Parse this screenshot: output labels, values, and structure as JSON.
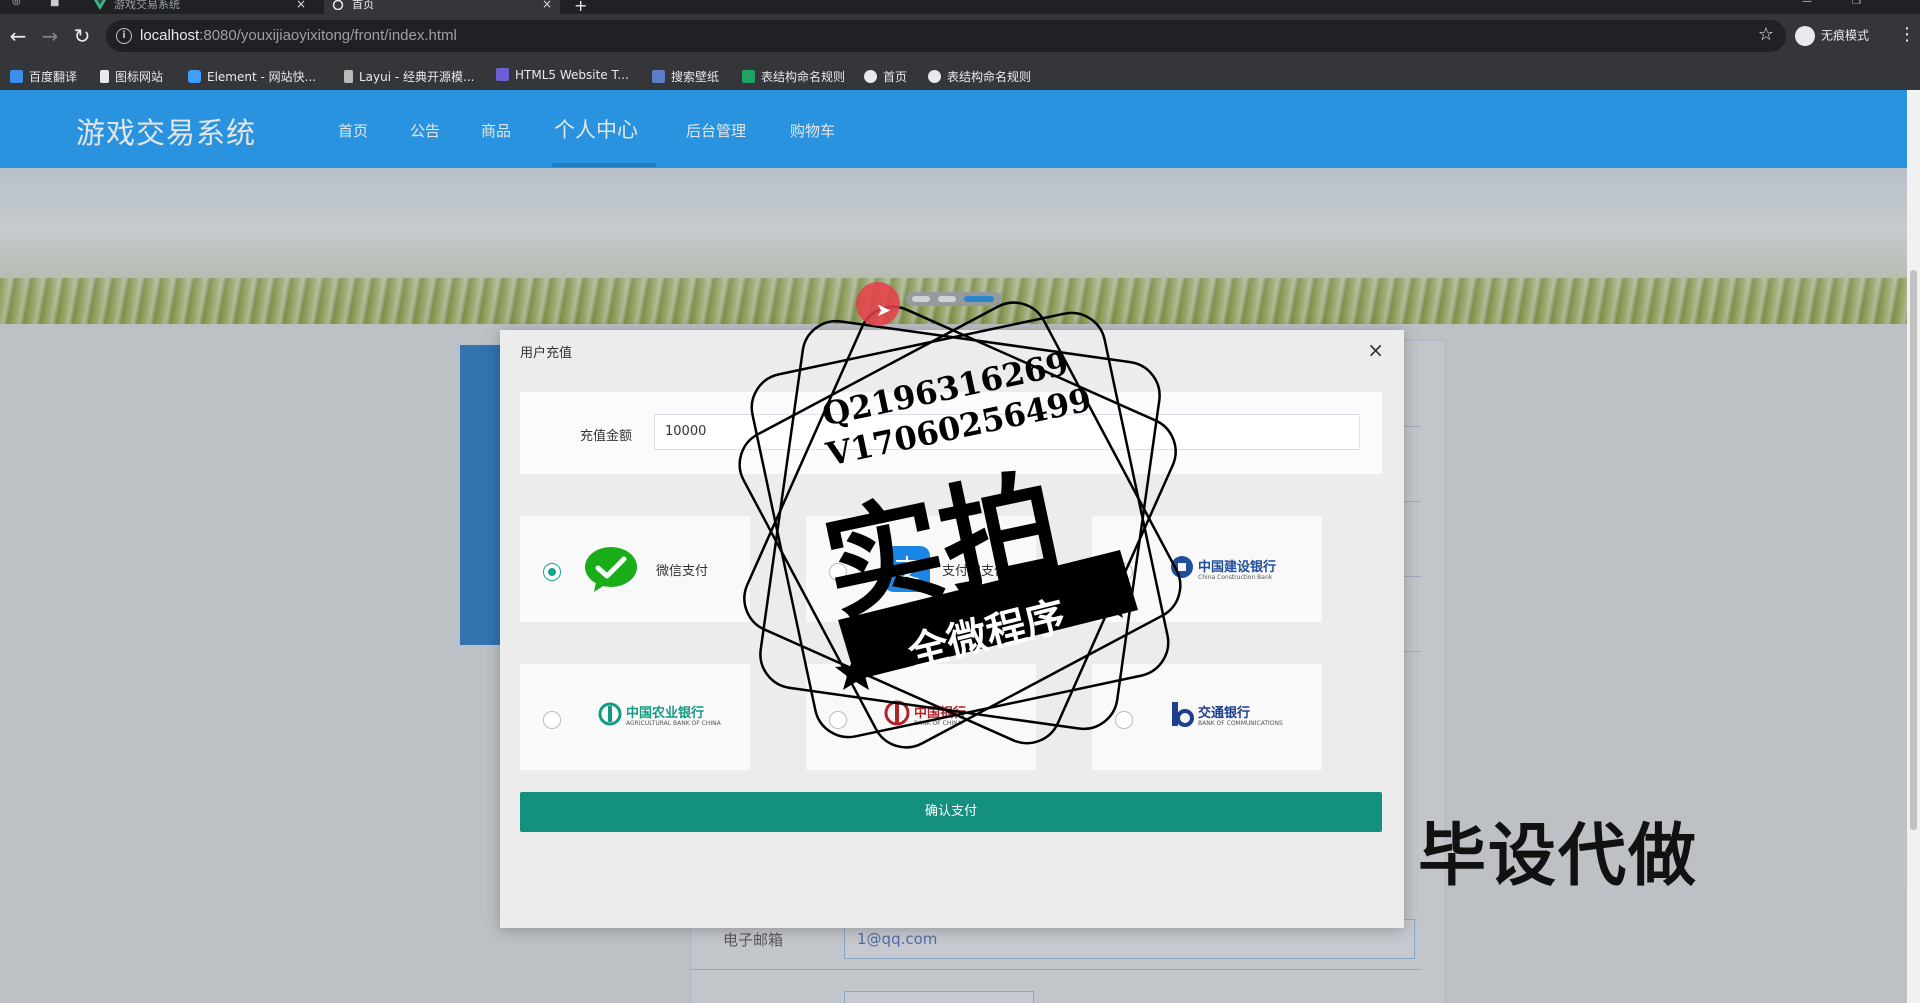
{
  "browser": {
    "tabs": [
      {
        "label": "游戏交易系统",
        "active": false
      },
      {
        "label": "首页",
        "active": true
      }
    ],
    "url_host": "localhost",
    "url_rest": ":8080/youxijiaoyixitong/front/index.html",
    "profile": "无痕模式",
    "bookmarks": [
      "百度翻译",
      "图标网站",
      "Element - 网站快...",
      "Layui - 经典开源模...",
      "HTML5 Website T...",
      "搜索壁纸",
      "表结构命名规则",
      "首页",
      "表结构命名规则"
    ]
  },
  "header": {
    "title": "游戏交易系统",
    "nav": [
      "首页",
      "公告",
      "商品",
      "个人中心",
      "后台管理",
      "购物车"
    ],
    "active_nav": "个人中心"
  },
  "background_form": {
    "email_label": "电子邮箱",
    "email_value": "1@qq.com"
  },
  "dialog": {
    "title": "用户充值",
    "close_symbol": "×",
    "amount_label": "充值金额",
    "amount_value": "10000",
    "payment_options": [
      {
        "label": "微信支付",
        "checked": true
      },
      {
        "label": "支付宝支付",
        "checked": false
      },
      {
        "label": "中国建设银行",
        "sub": "China Construction Bank",
        "checked": false
      },
      {
        "label": "中国农业银行",
        "sub": "AGRICULTURAL BANK OF CHINA",
        "checked": false
      },
      {
        "label": "中国银行",
        "sub": "BANK OF CHINA",
        "checked": false
      },
      {
        "label": "交通银行",
        "sub": "BANK OF COMMUNICATIONS",
        "checked": false
      }
    ],
    "confirm_label": "确认支付"
  },
  "watermark": {
    "line1": "Q2196316269",
    "line2": "V17060256499",
    "big": "实拍",
    "ribbon": "全微程序",
    "side": "毕设代做"
  },
  "colors": {
    "header_blue": "#1a9cf8",
    "confirm_green": "#14907e",
    "wechat_green": "#1aad19",
    "ccb_blue": "#1f4f9c",
    "abc_green": "#139a84",
    "boc_red": "#b3232a",
    "bocom_blue": "#1d3d8f"
  }
}
